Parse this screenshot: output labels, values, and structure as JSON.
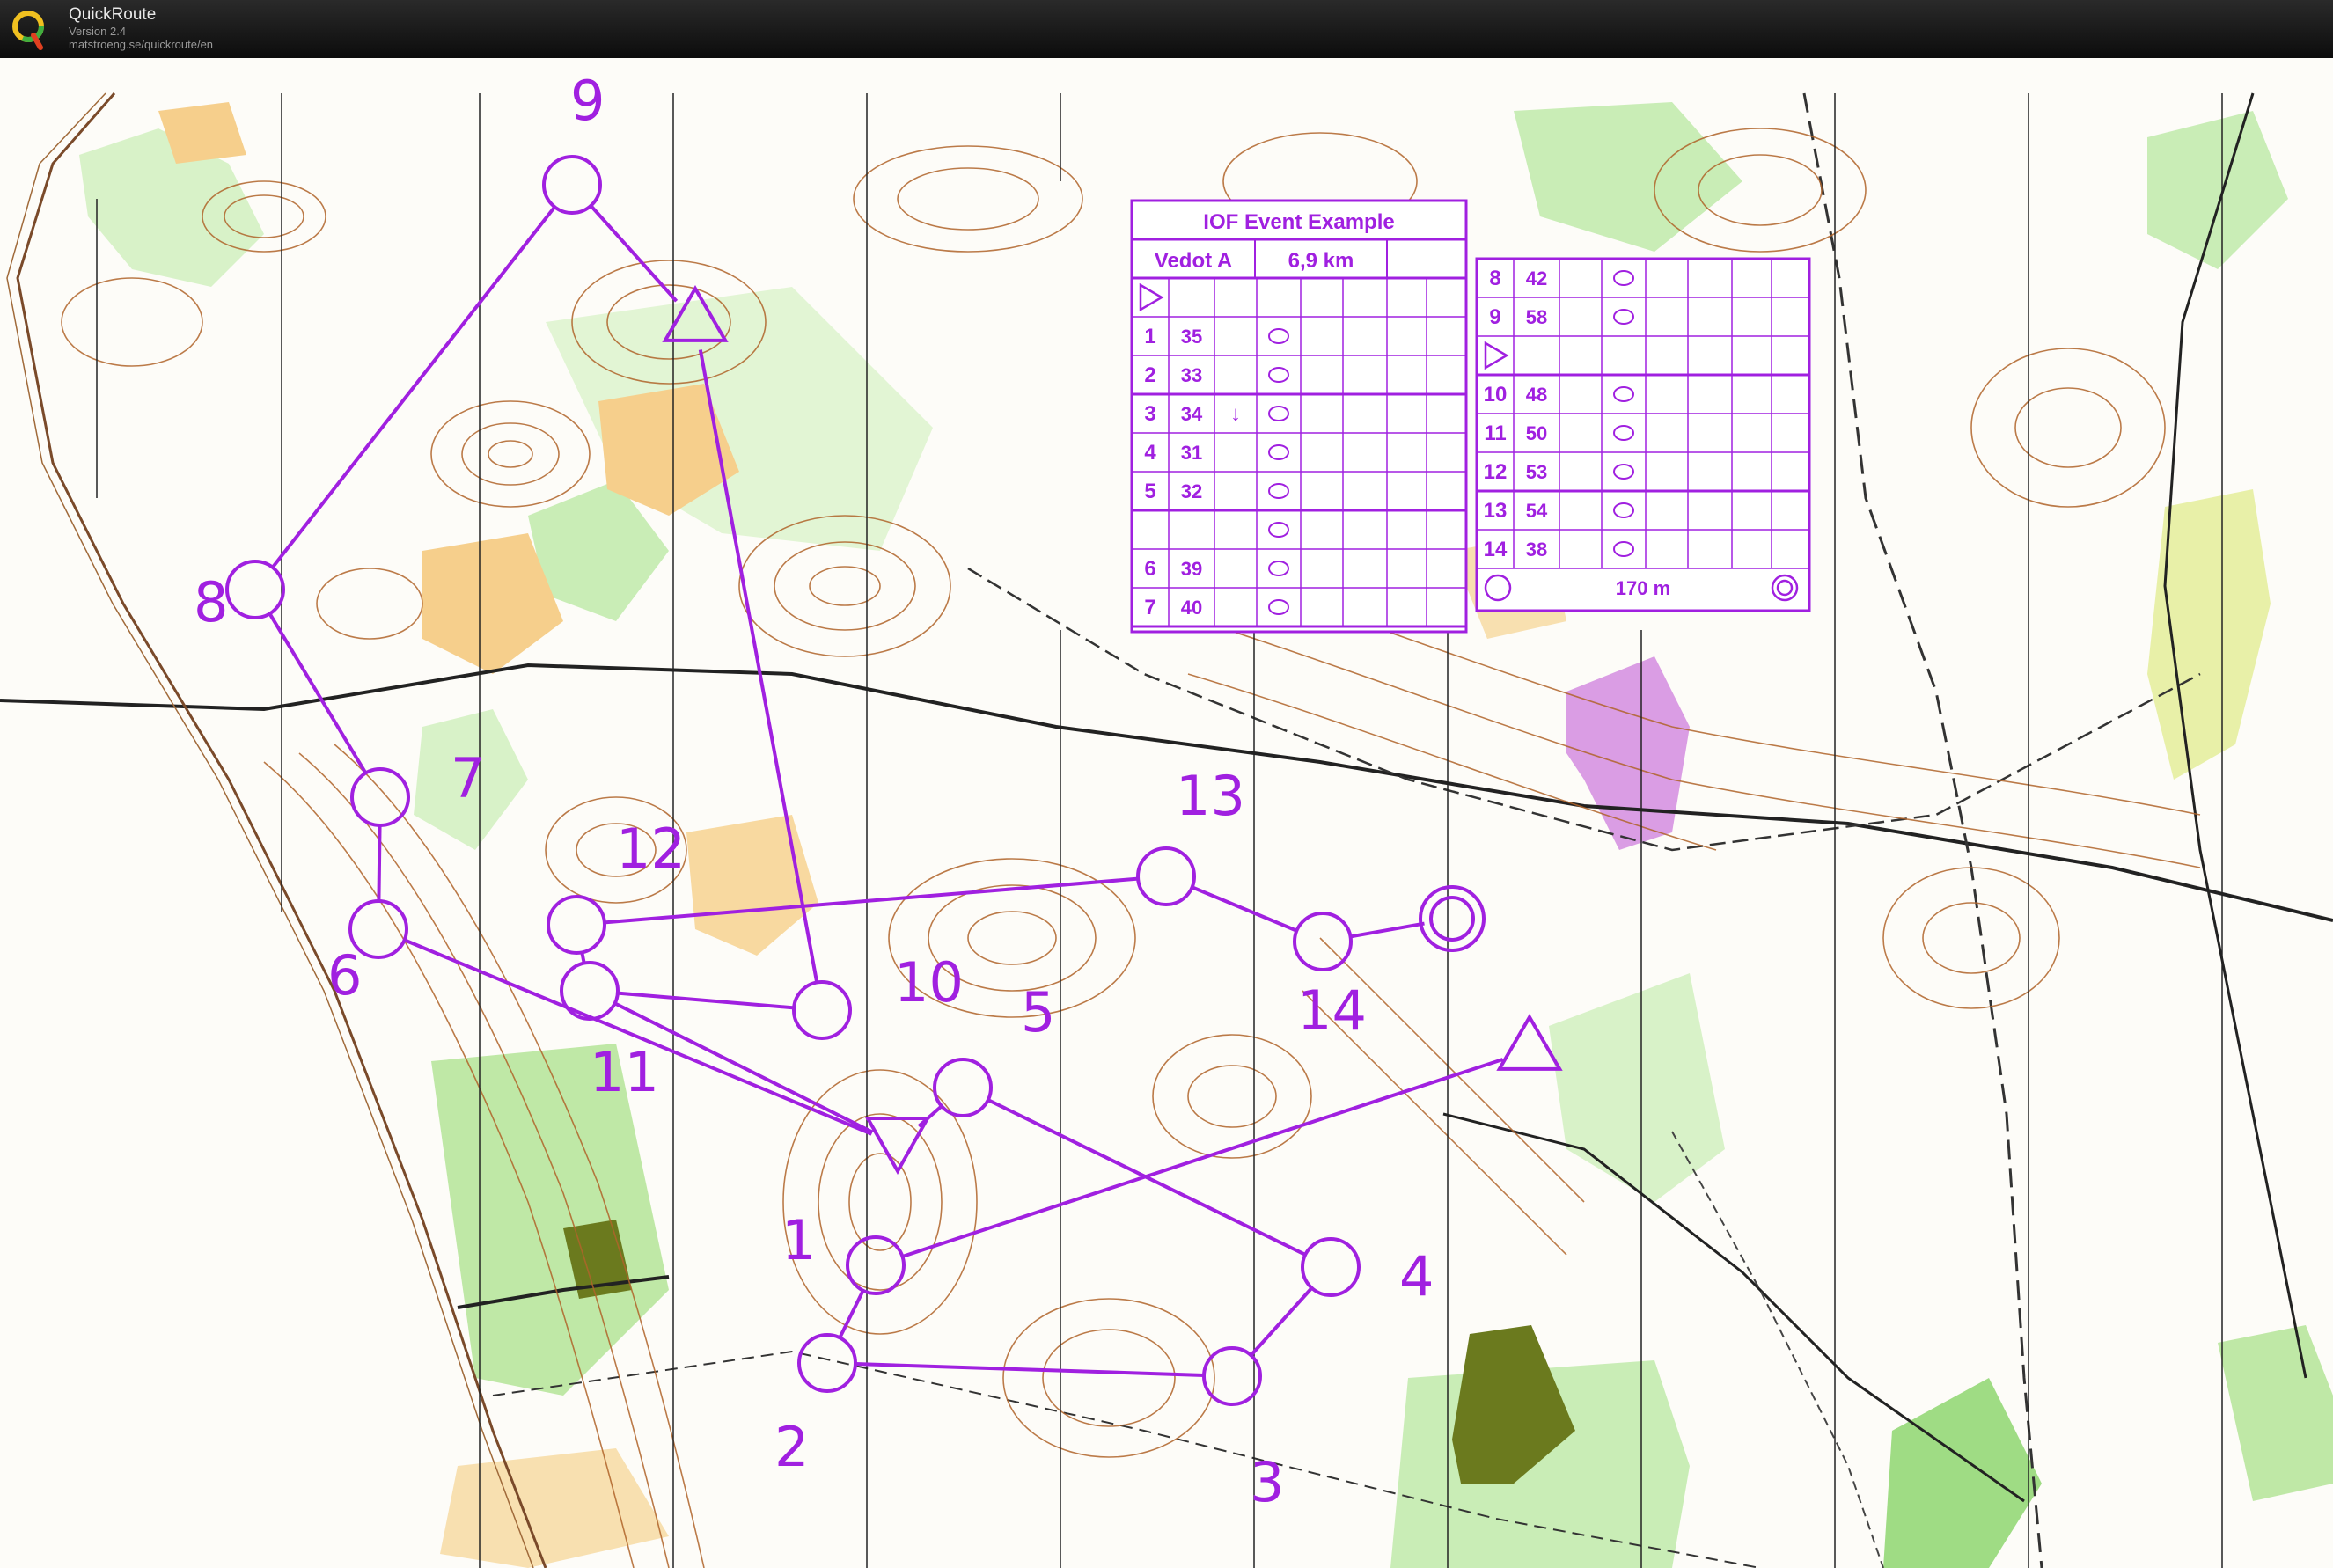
{
  "app": {
    "name": "QuickRoute",
    "version": "Version 2.4",
    "url": "matstroeng.se/quickroute/en",
    "logo_icon": "quickroute-q-logo-icon"
  },
  "colors": {
    "course": "#a020e0",
    "contour": "#b0642a",
    "vegetation_green": "#8fe07a",
    "open_land": "#f6c77a",
    "cultivated": "#6b7a1e"
  },
  "course": {
    "controls": [
      {
        "label": "1"
      },
      {
        "label": "2"
      },
      {
        "label": "3"
      },
      {
        "label": "4"
      },
      {
        "label": "5"
      },
      {
        "label": "6"
      },
      {
        "label": "7"
      },
      {
        "label": "8"
      },
      {
        "label": "9"
      },
      {
        "label": "10"
      },
      {
        "label": "11"
      },
      {
        "label": "12"
      },
      {
        "label": "13"
      },
      {
        "label": "14"
      }
    ]
  },
  "description_sheet": {
    "event_title": "IOF Event Example",
    "class_name": "Vedot A",
    "length": "6,9 km",
    "rows_left": [
      {
        "num": "1",
        "code": "35",
        "extra": ""
      },
      {
        "num": "2",
        "code": "33",
        "extra": ""
      },
      {
        "num": "3",
        "code": "34",
        "extra": "↓"
      },
      {
        "num": "4",
        "code": "31",
        "extra": ""
      },
      {
        "num": "5",
        "code": "32",
        "extra": ""
      },
      {
        "num": "6",
        "code": "39",
        "extra": ""
      },
      {
        "num": "7",
        "code": "40",
        "extra": ""
      }
    ],
    "rows_right": [
      {
        "num": "8",
        "code": "42"
      },
      {
        "num": "9",
        "code": "58"
      },
      {
        "num": "10",
        "code": "48"
      },
      {
        "num": "11",
        "code": "50"
      },
      {
        "num": "12",
        "code": "53"
      },
      {
        "num": "13",
        "code": "54"
      },
      {
        "num": "14",
        "code": "38"
      }
    ],
    "finish_distance": "170 m"
  }
}
